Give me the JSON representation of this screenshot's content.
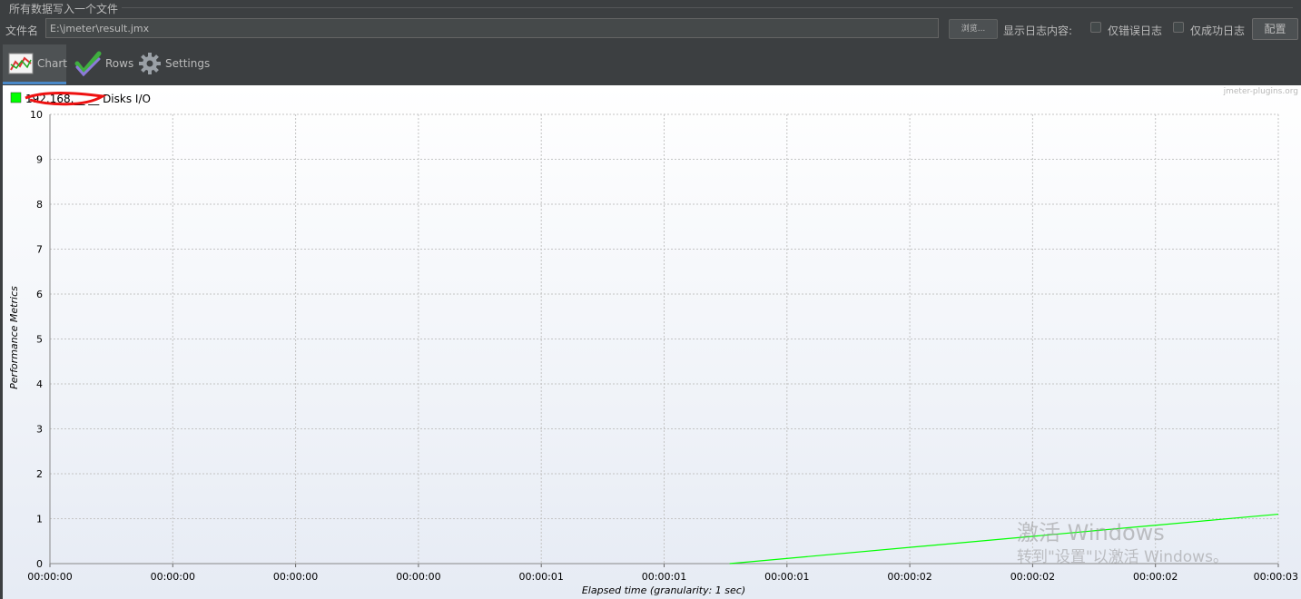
{
  "header": {
    "section_title": "所有数据写入一个文件"
  },
  "file": {
    "label": "文件名",
    "value": "E:\\jmeter\\result.jmx",
    "browse_label": "浏览...",
    "show_log_label": "显示日志内容:",
    "errors_only_label": "仅错误日志",
    "success_only_label": "仅成功日志",
    "config_label": "配置"
  },
  "tabs": [
    {
      "label": "Chart",
      "icon": "chart-icon",
      "active": true
    },
    {
      "label": "Rows",
      "icon": "checkmarks-icon",
      "active": false
    },
    {
      "label": "Settings",
      "icon": "gear-icon",
      "active": false
    }
  ],
  "chart_data": {
    "type": "line",
    "watermark": "jmeter-plugins.org",
    "ylabel": "Performance Metrics",
    "xlabel": "Elapsed time (granularity: 1 sec)",
    "ylim": [
      0,
      10
    ],
    "y_ticks": [
      "0",
      "1",
      "2",
      "3",
      "4",
      "5",
      "6",
      "7",
      "8",
      "9",
      "10"
    ],
    "x_ticks": [
      "00:00:00",
      "00:00:00",
      "00:00:00",
      "00:00:00",
      "00:00:01",
      "00:00:01",
      "00:00:01",
      "00:00:02",
      "00:00:02",
      "00:00:02",
      "00:00:03"
    ],
    "grid": true,
    "series": [
      {
        "name": "192.168.__.__ Disks I/O",
        "color": "#00ff00",
        "points": [
          [
            1.66,
            0
          ],
          [
            3.0,
            1.1
          ]
        ]
      }
    ],
    "xlim": [
      0,
      3
    ]
  },
  "os_watermark": {
    "line1": "激活 Windows",
    "line2": "转到\"设置\"以激活 Windows。"
  }
}
